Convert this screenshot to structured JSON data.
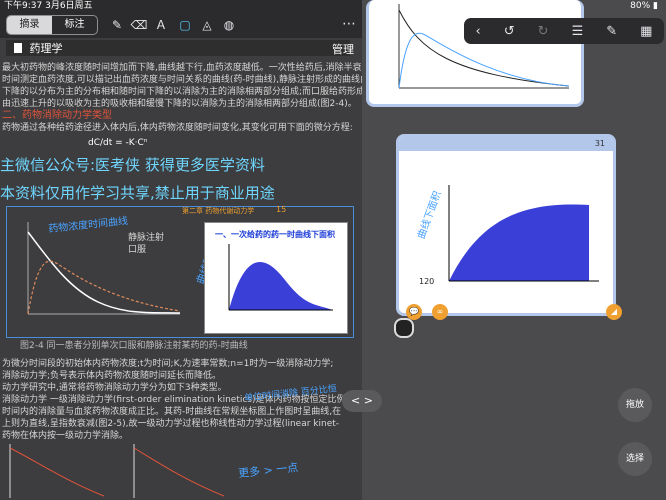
{
  "status": {
    "time": "下午9:37",
    "date": "3月6日周五",
    "battery": "80%"
  },
  "toolbar": {
    "seg_select": "摘录",
    "seg_annotate": "标注",
    "manage": "管理"
  },
  "book": {
    "title": "药理学"
  },
  "text": {
    "l1": "最大初药物的峰浓度随时间增加而下降,曲线越下行,血药浓度越低。一次性给药后,消除半衰期因药物固定而持续相同的浓度变化.",
    "l2": "时间测定血药浓度,可以描记出血药浓度与时间关系的曲线(药-时曲线),静脉注射形成的曲线由",
    "l3": "下降的以分布为主的分布相和随时间下降的以消除为主的消除相两部分组成;而口服给药形成的曲",
    "l4": "由迅速上升的以吸收为主的吸收相和缓慢下降的以消除为主的消除相两部分组成(图2-4)。",
    "section": "二、药物消除动力学类型",
    "l5": "药物通过各种给药途径进入体内后,体内药物浓度随时间变化,其变化可用下面的微分方程:",
    "equation": "dC/dt = -K·Cⁿ",
    "wm1": "主微信公众号:医考侠      获得更多医学资料",
    "wm2": "本资料仅用作学习共享,禁止用于商业用途",
    "hw1": "药物浓度时间曲线",
    "hw2": "曲线下面积",
    "slide_page": "15",
    "slide_header": "第二章  药物代谢动力学",
    "slide_title": "一、一次给药的药一时曲线下面积",
    "fig_caption": "图2-4  同一患者分别单次口服和静脉注射某药的药-时曲线",
    "l6": "为微分时间段的初始体内药物浓度;t为时间;K,为速率常数;n=1时为一级消除动力学;",
    "l7": "消除动力学;负号表示体内药物浓度随时间延长而降低。",
    "l8": "动力学研究中,通常将药物消除动力学分为如下3种类型。",
    "l9": "消除动力学  一级消除动力学(first-order elimination kinetics)是体内药物按恒定比例消",
    "l10": "时间内的消除量与血浆药物浓度成正比。其药-时曲线在常规坐标图上作图时呈曲线,在",
    "l11": "上则为直线,呈指数衰减(图2-5),故一级动力学过程也称线性动力学过程(linear kinet-",
    "l12": "药物在体内按一级动力学消除。",
    "hw3": "单位时间消除 百分比恒",
    "hw4": "曲线下面积",
    "hw5": "更多 > 一点"
  },
  "legend": {
    "iv": "静脉注射",
    "oral": "口服"
  },
  "right_cards": {
    "card2_page": "31",
    "card_axis": "120"
  },
  "side_buttons": {
    "drag": "拖放",
    "select": "选择"
  },
  "handle": "< >",
  "colors": {
    "accent": "#4aa3ff",
    "card_border": "#b3c7ea",
    "section_red": "#e0533b"
  }
}
